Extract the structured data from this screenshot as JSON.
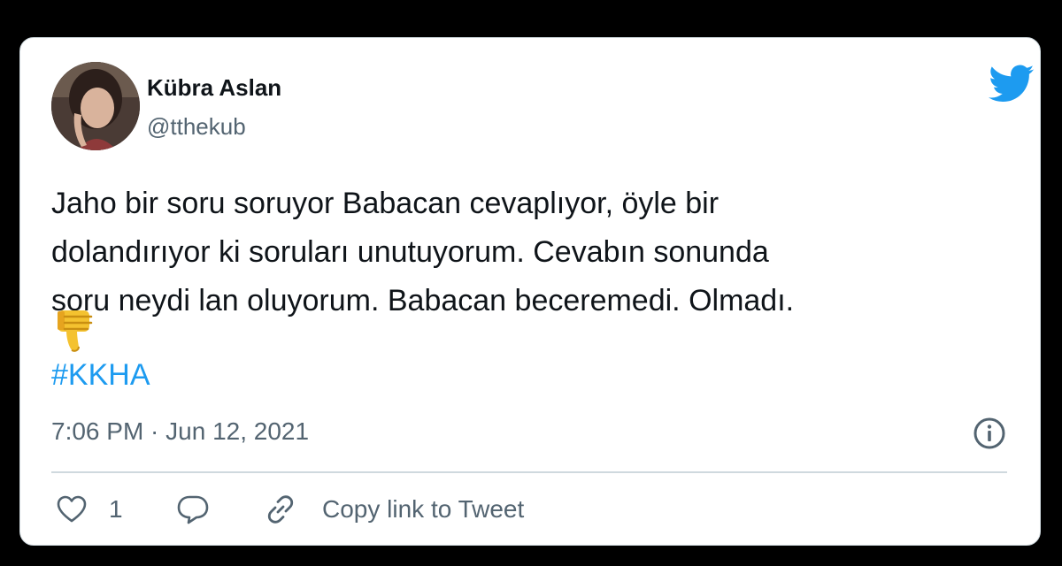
{
  "author": {
    "display_name": "Kübra Aslan",
    "handle": "@tthekub"
  },
  "tweet": {
    "lines": [
      "Jaho bir soru soruyor Babacan cevaplıyor, öyle bir",
      "dolandırıyor ki soruları unutuyorum. Cevabın sonunda",
      "soru neydi lan oluyorum. Babacan beceremedi. Olmadı."
    ],
    "emoji": "thumbs-down",
    "hashtag": "#KKHA",
    "timestamp": "7:06 PM · Jun 12, 2021"
  },
  "actions": {
    "like_count": "1",
    "copy_link_label": "Copy link to Tweet"
  },
  "icons": {
    "brand": "twitter-bird-icon",
    "info": "info-icon",
    "like": "heart-icon",
    "reply": "speech-bubble-icon",
    "copy": "link-icon"
  },
  "colors": {
    "accent": "#1d9bf0",
    "text": "#0f1419",
    "secondary": "#536471",
    "border": "#cfd9de"
  }
}
